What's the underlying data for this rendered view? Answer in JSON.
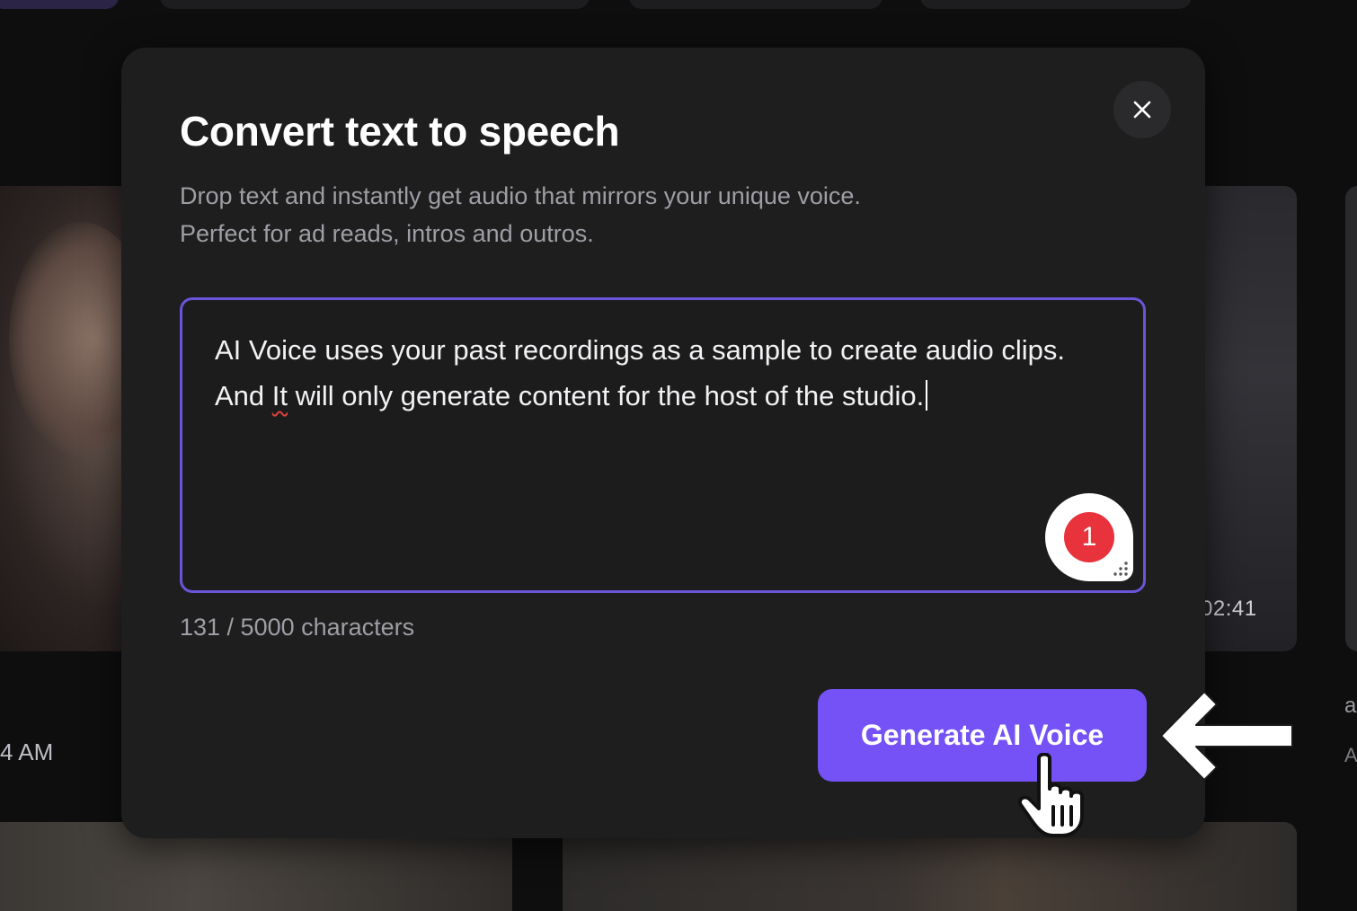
{
  "background": {
    "thumbnail_duration": "02:41",
    "left_timestamp": "4 AM",
    "right_edge_texts": [
      "a",
      "A"
    ]
  },
  "modal": {
    "title": "Convert text to speech",
    "subtitle_line1": "Drop text and instantly get audio that mirrors your unique voice.",
    "subtitle_line2": "Perfect for ad reads, intros and outros.",
    "close_icon": "close-icon",
    "textarea": {
      "value_part1": "AI Voice uses your past recordings as a sample to create audio clips. And ",
      "value_misspelled": "It",
      "value_part2": " will only generate content for the host of the studio."
    },
    "badge_count": "1",
    "char_count": "131 / 5000 characters",
    "generate_label": "Generate AI Voice"
  },
  "colors": {
    "accent": "#7452f5",
    "textarea_border": "#6a55d8",
    "badge": "#e8323c",
    "modal_bg": "#1e1e1f"
  },
  "annotations": {
    "arrow_icon": "arrow-left-icon",
    "cursor_icon": "hand-pointer-icon"
  }
}
